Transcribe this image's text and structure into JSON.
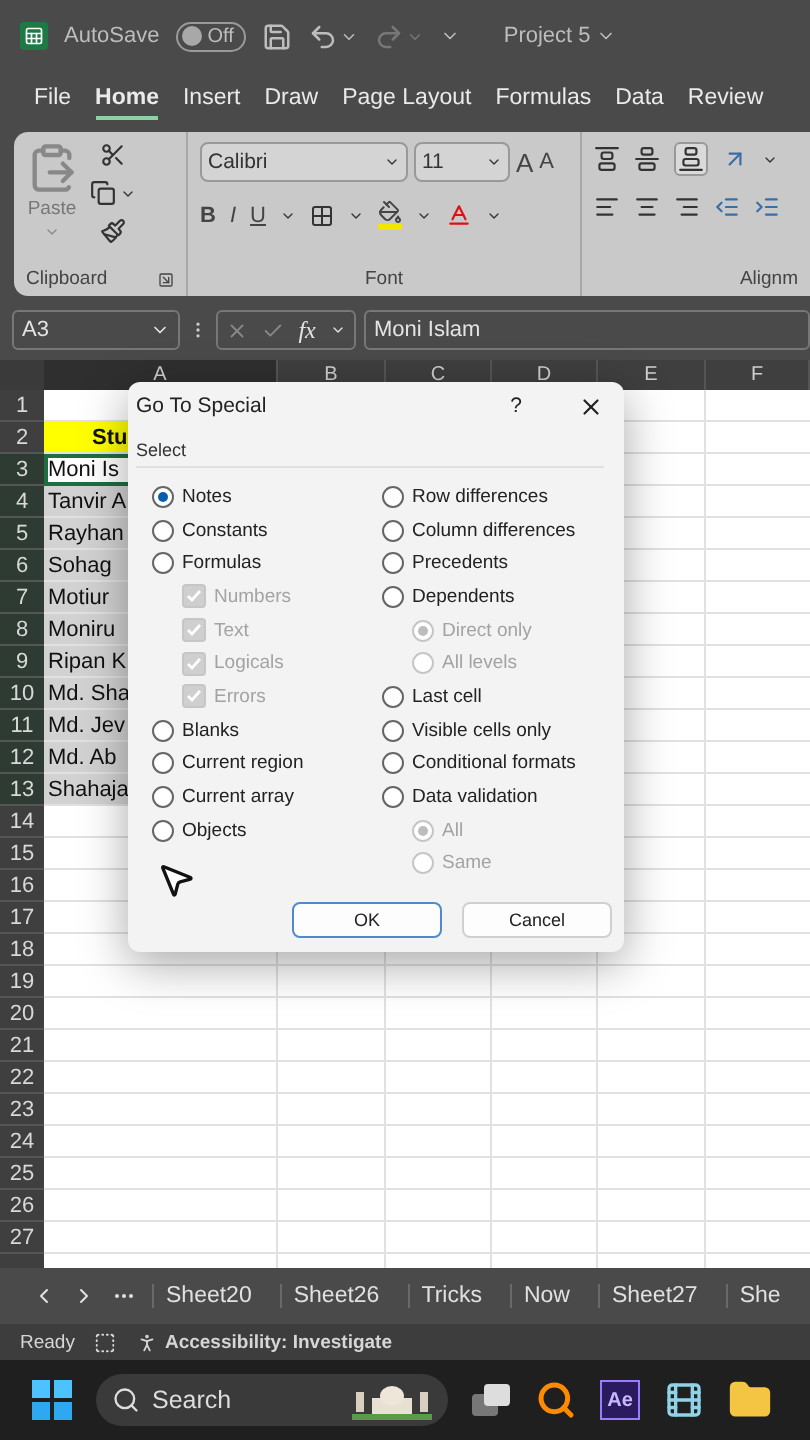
{
  "title_bar": {
    "autosave_label": "AutoSave",
    "autosave_toggle": {
      "label": "Off",
      "on": false
    },
    "document": "Project 5"
  },
  "ribbon_tabs": [
    {
      "label": "File",
      "selected": false
    },
    {
      "label": "Home",
      "selected": true
    },
    {
      "label": "Insert",
      "selected": false
    },
    {
      "label": "Draw",
      "selected": false
    },
    {
      "label": "Page Layout",
      "selected": false
    },
    {
      "label": "Formulas",
      "selected": false
    },
    {
      "label": "Data",
      "selected": false
    },
    {
      "label": "Review",
      "selected": false
    }
  ],
  "ribbon": {
    "clipboard": {
      "paste_label": "Paste",
      "group_label": "Clipboard"
    },
    "font": {
      "font_name": "Calibri",
      "font_size": "11",
      "grow": "A",
      "shrink": "A",
      "bold": "B",
      "italic": "I",
      "underline": "U",
      "group_label": "Font"
    },
    "alignment": {
      "group_label": "Alignm"
    }
  },
  "formula_bar": {
    "name_box": "A3",
    "fx": "fx",
    "value": "Moni Islam"
  },
  "grid": {
    "columns": [
      "A",
      "B",
      "C",
      "D",
      "E",
      "F"
    ],
    "rows": [
      {
        "header": "1",
        "kind": "empty",
        "selected": false
      },
      {
        "header": "2",
        "kind": "heading",
        "cell": "Stu",
        "selected": false
      },
      {
        "header": "3",
        "kind": "name",
        "cell": "Moni Is",
        "selected": true,
        "active": true
      },
      {
        "header": "4",
        "kind": "name",
        "cell": "Tanvir A",
        "selected": true,
        "active": false
      },
      {
        "header": "5",
        "kind": "name",
        "cell": "Rayhan",
        "selected": true,
        "active": false
      },
      {
        "header": "6",
        "kind": "name",
        "cell": "Sohag",
        "selected": true,
        "active": false
      },
      {
        "header": "7",
        "kind": "name",
        "cell": "Motiur",
        "selected": true,
        "active": false
      },
      {
        "header": "8",
        "kind": "name",
        "cell": "Moniru",
        "selected": true,
        "active": false
      },
      {
        "header": "9",
        "kind": "name",
        "cell": "Ripan K",
        "selected": true,
        "active": false
      },
      {
        "header": "10",
        "kind": "name",
        "cell": "Md. Sha",
        "selected": true,
        "active": false
      },
      {
        "header": "11",
        "kind": "name",
        "cell": "Md. Jev",
        "selected": true,
        "active": false
      },
      {
        "header": "12",
        "kind": "name",
        "cell": "Md. Ab",
        "selected": true,
        "active": false
      },
      {
        "header": "13",
        "kind": "name",
        "cell": "Shahaja",
        "selected": true,
        "active": false
      },
      {
        "header": "14",
        "kind": "empty",
        "selected": false
      },
      {
        "header": "15",
        "kind": "empty",
        "selected": false
      },
      {
        "header": "16",
        "kind": "empty",
        "selected": false
      },
      {
        "header": "17",
        "kind": "empty",
        "selected": false
      },
      {
        "header": "18",
        "kind": "empty",
        "selected": false
      },
      {
        "header": "19",
        "kind": "empty",
        "selected": false
      },
      {
        "header": "20",
        "kind": "empty",
        "selected": false
      },
      {
        "header": "21",
        "kind": "empty",
        "selected": false
      },
      {
        "header": "22",
        "kind": "empty",
        "selected": false
      },
      {
        "header": "23",
        "kind": "empty",
        "selected": false
      },
      {
        "header": "24",
        "kind": "empty",
        "selected": false
      },
      {
        "header": "25",
        "kind": "empty",
        "selected": false
      },
      {
        "header": "26",
        "kind": "empty",
        "selected": false
      },
      {
        "header": "27",
        "kind": "empty",
        "selected": false
      }
    ]
  },
  "dialog": {
    "title": "Go To Special",
    "help": "?",
    "section": "Select",
    "left_options": [
      {
        "kind": "radio",
        "label": "Notes",
        "selected": true,
        "disabled": false
      },
      {
        "kind": "radio",
        "label": "Constants",
        "selected": false,
        "disabled": false
      },
      {
        "kind": "radio",
        "label": "Formulas",
        "selected": false,
        "disabled": false,
        "children": [
          {
            "kind": "check",
            "label": "Numbers",
            "checked": true,
            "disabled": true
          },
          {
            "kind": "check",
            "label": "Text",
            "checked": true,
            "disabled": true
          },
          {
            "kind": "check",
            "label": "Logicals",
            "checked": true,
            "disabled": true
          },
          {
            "kind": "check",
            "label": "Errors",
            "checked": true,
            "disabled": true
          }
        ]
      },
      {
        "kind": "radio",
        "label": "Blanks",
        "selected": false,
        "disabled": false
      },
      {
        "kind": "radio",
        "label": "Current region",
        "selected": false,
        "disabled": false
      },
      {
        "kind": "radio",
        "label": "Current array",
        "selected": false,
        "disabled": false
      },
      {
        "kind": "radio",
        "label": "Objects",
        "selected": false,
        "disabled": false
      }
    ],
    "right_options": [
      {
        "kind": "radio",
        "label": "Row differences",
        "selected": false,
        "disabled": false
      },
      {
        "kind": "radio",
        "label": "Column differences",
        "selected": false,
        "disabled": false
      },
      {
        "kind": "radio",
        "label": "Precedents",
        "selected": false,
        "disabled": false
      },
      {
        "kind": "radio",
        "label": "Dependents",
        "selected": false,
        "disabled": false,
        "children": [
          {
            "kind": "radio",
            "label": "Direct only",
            "selected": true,
            "disabled": true
          },
          {
            "kind": "radio",
            "label": "All levels",
            "selected": false,
            "disabled": true
          }
        ]
      },
      {
        "kind": "radio",
        "label": "Last cell",
        "selected": false,
        "disabled": false
      },
      {
        "kind": "radio",
        "label": "Visible cells only",
        "selected": false,
        "disabled": false
      },
      {
        "kind": "radio",
        "label": "Conditional formats",
        "selected": false,
        "disabled": false
      },
      {
        "kind": "radio",
        "label": "Data validation",
        "selected": false,
        "disabled": false,
        "children": [
          {
            "kind": "radio",
            "label": "All",
            "selected": true,
            "disabled": true
          },
          {
            "kind": "radio",
            "label": "Same",
            "selected": false,
            "disabled": true
          }
        ]
      }
    ],
    "buttons": [
      {
        "label": "OK",
        "default": true
      },
      {
        "label": "Cancel",
        "default": false
      }
    ]
  },
  "sheet_tabs": [
    "Sheet20",
    "Sheet26",
    "Tricks",
    "Now",
    "Sheet27",
    "She"
  ],
  "status_bar": {
    "ready": "Ready",
    "accessibility": "Accessibility: Investigate"
  },
  "taskbar": {
    "search_placeholder": "Search",
    "ae_label": "Ae"
  }
}
